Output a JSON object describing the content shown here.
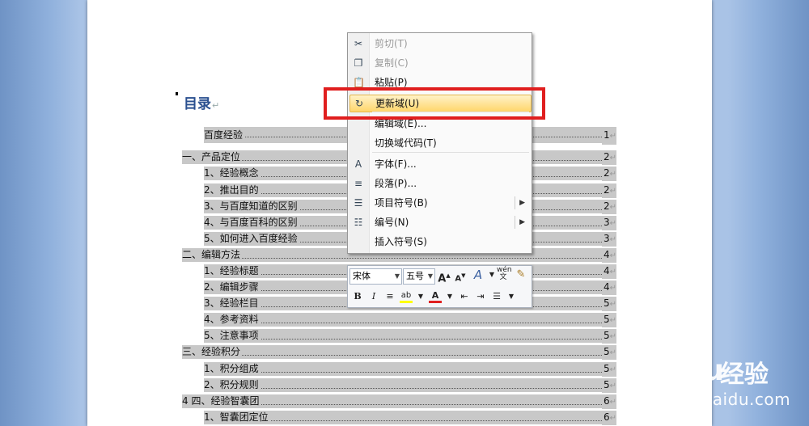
{
  "document": {
    "heading": "目录",
    "para_mark": "↵",
    "toc": [
      {
        "text": "百度经验",
        "page": "1",
        "level": 2
      },
      {
        "text": "一、产品定位",
        "page": "2",
        "level": 1
      },
      {
        "text": "1、经验概念",
        "page": "2",
        "level": 2
      },
      {
        "text": "2、推出目的",
        "page": "2",
        "level": 2
      },
      {
        "text": "3、与百度知道的区别",
        "page": "2",
        "level": 2
      },
      {
        "text": "4、与百度百科的区别",
        "page": "3",
        "level": 2
      },
      {
        "text": "5、如何进入百度经验",
        "page": "3",
        "level": 2
      },
      {
        "text": "二、编辑方法",
        "page": "4",
        "level": 1
      },
      {
        "text": "1、经验标题",
        "page": "4",
        "level": 2
      },
      {
        "text": "2、编辑步骤",
        "page": "4",
        "level": 2
      },
      {
        "text": "3、经验栏目",
        "page": "5",
        "level": 2
      },
      {
        "text": "4、参考资料",
        "page": "5",
        "level": 2
      },
      {
        "text": "5、注意事项",
        "page": "5",
        "level": 2
      },
      {
        "text": "三、经验积分",
        "page": "5",
        "level": 1
      },
      {
        "text": "1、积分组成",
        "page": "5",
        "level": 2
      },
      {
        "text": "2、积分规则",
        "page": "5",
        "level": 2
      },
      {
        "text": "4 四、经验智囊团",
        "page": "6",
        "level": 1
      },
      {
        "text": "1、智囊团定位",
        "page": "6",
        "level": 2
      }
    ]
  },
  "context_menu": {
    "items": [
      {
        "label": "剪切(T)",
        "icon": "scissors-icon",
        "glyph": "✂",
        "disabled": true
      },
      {
        "label": "复制(C)",
        "icon": "copy-icon",
        "glyph": "❐",
        "disabled": true
      },
      {
        "label": "粘贴(P)",
        "icon": "paste-icon",
        "glyph": "📋",
        "disabled": false
      },
      {
        "label": "更新域(U)",
        "icon": "update-field-icon",
        "glyph": "↻",
        "disabled": false,
        "highlighted": true
      },
      {
        "label": "编辑域(E)...",
        "icon": "",
        "glyph": "",
        "disabled": false
      },
      {
        "label": "切换域代码(T)",
        "icon": "",
        "glyph": "",
        "disabled": false
      },
      {
        "label": "字体(F)...",
        "icon": "font-icon",
        "glyph": "A",
        "disabled": false
      },
      {
        "label": "段落(P)...",
        "icon": "paragraph-icon",
        "glyph": "≡",
        "disabled": false
      },
      {
        "label": "项目符号(B)",
        "icon": "bullets-icon",
        "glyph": "☰",
        "disabled": false,
        "submenu": true
      },
      {
        "label": "编号(N)",
        "icon": "numbering-icon",
        "glyph": "☷",
        "disabled": false,
        "submenu": true
      },
      {
        "label": "插入符号(S)",
        "icon": "",
        "glyph": "",
        "disabled": false
      }
    ]
  },
  "mini_toolbar": {
    "font_name": "宋体",
    "font_size": "五号",
    "grow_font": "A",
    "shrink_font": "A",
    "styles": "A",
    "phonetic": "wén\n文",
    "bold": "B",
    "italic": "I",
    "font_color": "A"
  },
  "watermark": {
    "logo": "Bai du",
    "product": "经验",
    "url": "jingyan.baidu.com"
  },
  "colors": {
    "highlight": "#ffd66b",
    "red_box": "#e01e1e",
    "toc_shading": "#c8c8c8"
  }
}
